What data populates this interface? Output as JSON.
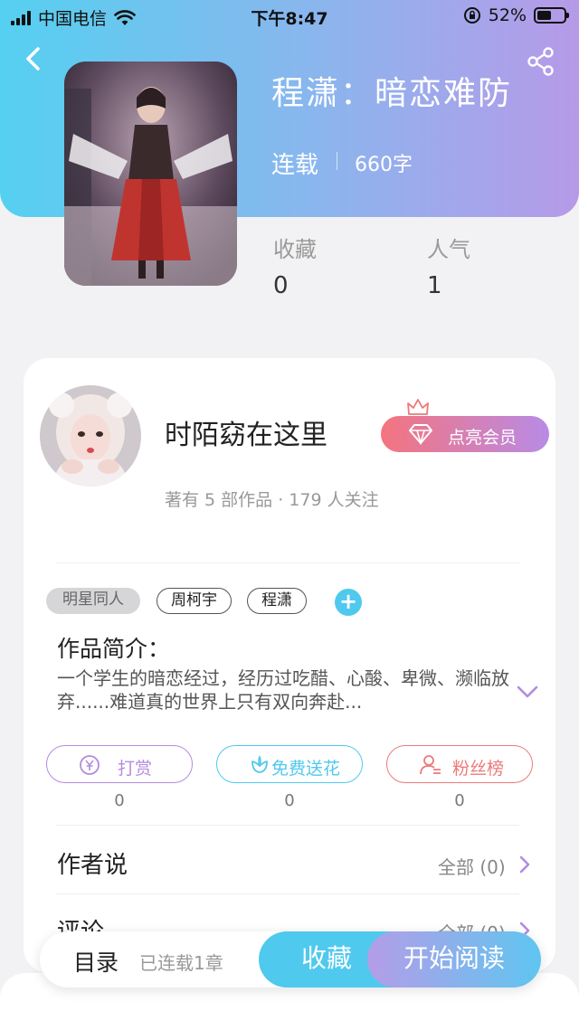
{
  "status_bar": {
    "carrier": "中国电信",
    "time": "下午8:47",
    "battery": "52%",
    "battery_level": 0.52
  },
  "book": {
    "title": "程潇：暗恋难防",
    "status": "连载",
    "word_count": "660字"
  },
  "stats": [
    {
      "label": "收藏",
      "value": "0"
    },
    {
      "label": "人气",
      "value": "1"
    }
  ],
  "author": {
    "name": "时陌窈在这里",
    "meta": "著有 5 部作品 · 179 人关注",
    "vip_button": "点亮会员"
  },
  "tags": [
    "明星同人",
    "周柯宇",
    "程潇"
  ],
  "intro": {
    "title": "作品简介：",
    "text": "一个学生的暗恋经过，经历过吃醋、心酸、卑微、濒临放弃......难道真的世界上只有双向奔赴..."
  },
  "actions": [
    {
      "label": "打赏",
      "count": "0",
      "color": "#b48be0"
    },
    {
      "label": "免费送花",
      "count": "0",
      "color": "#4fc9ee"
    },
    {
      "label": "粉丝榜",
      "count": "0",
      "color": "#ec7a7a"
    }
  ],
  "sections": {
    "author_says": {
      "title": "作者说",
      "more": "全部 (0)"
    },
    "comments": {
      "title": "评论",
      "more": "全部 (0)"
    }
  },
  "bottom_bar": {
    "toc": "目录",
    "chapter_info": "已连载1章",
    "favorite": "收藏",
    "read": "开始阅读"
  }
}
